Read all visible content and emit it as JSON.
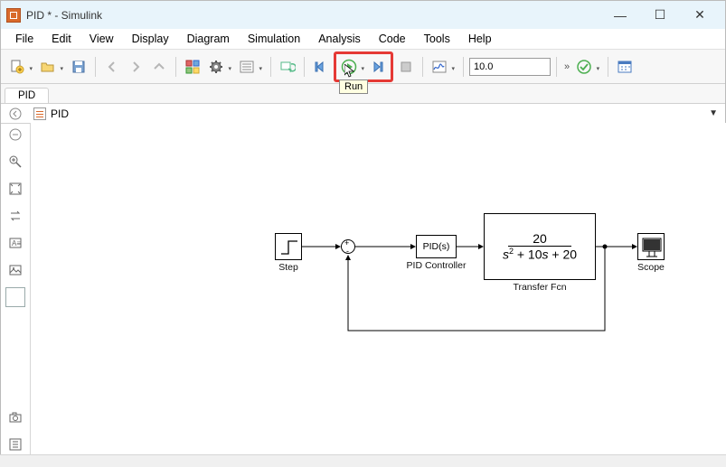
{
  "window": {
    "title": "PID * - Simulink",
    "min_glyph": "—",
    "max_glyph": "☐",
    "close_glyph": "✕"
  },
  "menu": {
    "items": [
      "File",
      "Edit",
      "View",
      "Display",
      "Diagram",
      "Simulation",
      "Analysis",
      "Code",
      "Tools",
      "Help"
    ]
  },
  "toolbar": {
    "stop_time": "10.0",
    "fast_fwd": "»",
    "run_tooltip": "Run"
  },
  "tab": {
    "label": "PID"
  },
  "breadcrumb": {
    "model": "PID"
  },
  "diagram": {
    "step": {
      "label": "Step"
    },
    "pid": {
      "text": "PID(s)",
      "label": "PID Controller"
    },
    "tf": {
      "numerator": "20",
      "denominator_html": "<i>s</i><sup>2</sup> + 10<i>s</i> + 20",
      "label": "Transfer Fcn"
    },
    "scope": {
      "label": "Scope"
    }
  }
}
